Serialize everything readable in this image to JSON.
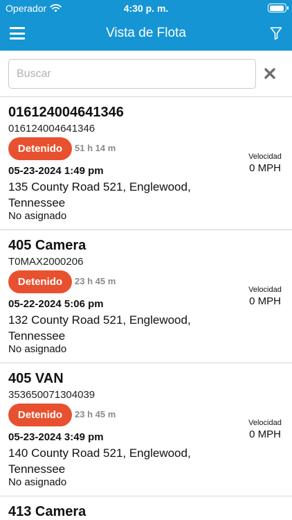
{
  "status_bar": {
    "carrier": "Operador",
    "time": "4:30 p. m."
  },
  "nav": {
    "title": "Vista de Flota",
    "menu_icon": "hamburger-icon",
    "filter_icon": "filter-icon"
  },
  "search": {
    "placeholder": "Buscar",
    "value": "",
    "clear_icon": "close-icon"
  },
  "colors": {
    "header": "#1595d3",
    "stopped_badge": "#e8512f"
  },
  "vehicles": [
    {
      "name": "016124004641346",
      "device_id": "016124004641346",
      "status": "Detenido",
      "duration": "51 h 14 m",
      "datetime": "05-23-2024 1:49 pm",
      "address": "135 County Road 521, Englewood, Tennessee",
      "assignment": "No asignado",
      "speed_label": "Velocidad",
      "speed": "0 MPH"
    },
    {
      "name": "405 Camera",
      "device_id": "T0MAX2000206",
      "status": "Detenido",
      "duration": "23 h 45 m",
      "datetime": "05-22-2024 5:06 pm",
      "address": "132 County Road 521, Englewood, Tennessee",
      "assignment": "No asignado",
      "speed_label": "Velocidad",
      "speed": "0 MPH"
    },
    {
      "name": "405 VAN",
      "device_id": "353650071304039",
      "status": "Detenido",
      "duration": "23 h 45 m",
      "datetime": "05-23-2024 3:49 pm",
      "address": "140 County Road 521, Englewood, Tennessee",
      "assignment": "No asignado",
      "speed_label": "Velocidad",
      "speed": "0 MPH"
    },
    {
      "name": "413 Camera"
    }
  ]
}
